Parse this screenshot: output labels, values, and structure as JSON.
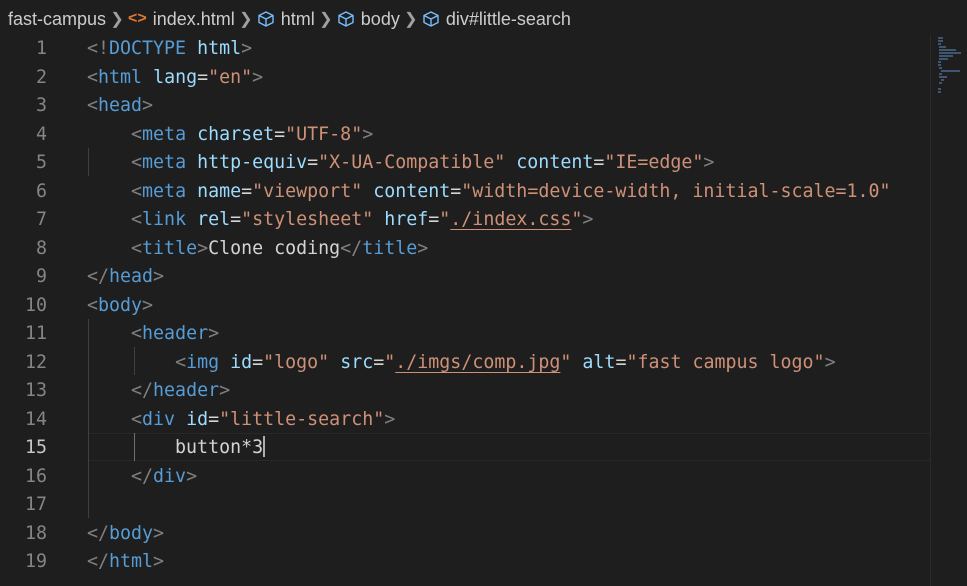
{
  "breadcrumb": {
    "items": [
      {
        "label": "fast-campus",
        "icon": null
      },
      {
        "label": "index.html",
        "icon": "html-file-icon"
      },
      {
        "label": "html",
        "icon": "element-cube-icon"
      },
      {
        "label": "body",
        "icon": "element-cube-icon"
      },
      {
        "label": "div#little-search",
        "icon": "element-cube-icon"
      }
    ]
  },
  "editor": {
    "active_line": 15,
    "line_numbers": [
      "1",
      "2",
      "3",
      "4",
      "5",
      "6",
      "7",
      "8",
      "9",
      "10",
      "11",
      "12",
      "13",
      "14",
      "15",
      "16",
      "17",
      "18",
      "19"
    ],
    "lines": [
      [
        [
          "br",
          "<!"
        ],
        [
          "tag",
          "DOCTYPE"
        ],
        [
          "txt",
          " "
        ],
        [
          "attr",
          "html"
        ],
        [
          "br",
          ">"
        ]
      ],
      [
        [
          "br",
          "<"
        ],
        [
          "tag",
          "html"
        ],
        [
          "txt",
          " "
        ],
        [
          "attr",
          "lang"
        ],
        [
          "txt",
          "="
        ],
        [
          "str",
          "\"en\""
        ],
        [
          "br",
          ">"
        ]
      ],
      [
        [
          "br",
          "<"
        ],
        [
          "tag",
          "head"
        ],
        [
          "br",
          ">"
        ]
      ],
      [
        [
          "txt",
          "    "
        ],
        [
          "br",
          "<"
        ],
        [
          "tag",
          "meta"
        ],
        [
          "txt",
          " "
        ],
        [
          "attr",
          "charset"
        ],
        [
          "txt",
          "="
        ],
        [
          "str",
          "\"UTF-8\""
        ],
        [
          "br",
          ">"
        ]
      ],
      [
        [
          "txt",
          "    "
        ],
        [
          "br",
          "<"
        ],
        [
          "tag",
          "meta"
        ],
        [
          "txt",
          " "
        ],
        [
          "attr",
          "http-equiv"
        ],
        [
          "txt",
          "="
        ],
        [
          "str",
          "\"X-UA-Compatible\""
        ],
        [
          "txt",
          " "
        ],
        [
          "attr",
          "content"
        ],
        [
          "txt",
          "="
        ],
        [
          "str",
          "\"IE=edge\""
        ],
        [
          "br",
          ">"
        ]
      ],
      [
        [
          "txt",
          "    "
        ],
        [
          "br",
          "<"
        ],
        [
          "tag",
          "meta"
        ],
        [
          "txt",
          " "
        ],
        [
          "attr",
          "name"
        ],
        [
          "txt",
          "="
        ],
        [
          "str",
          "\"viewport\""
        ],
        [
          "txt",
          " "
        ],
        [
          "attr",
          "content"
        ],
        [
          "txt",
          "="
        ],
        [
          "str",
          "\"width=device-width, initial-scale=1.0\""
        ]
      ],
      [
        [
          "txt",
          "    "
        ],
        [
          "br",
          "<"
        ],
        [
          "tag",
          "link"
        ],
        [
          "txt",
          " "
        ],
        [
          "attr",
          "rel"
        ],
        [
          "txt",
          "="
        ],
        [
          "str",
          "\"stylesheet\""
        ],
        [
          "txt",
          " "
        ],
        [
          "attr",
          "href"
        ],
        [
          "txt",
          "="
        ],
        [
          "str",
          "\""
        ],
        [
          "link",
          "./index.css"
        ],
        [
          "str",
          "\""
        ],
        [
          "br",
          ">"
        ]
      ],
      [
        [
          "txt",
          "    "
        ],
        [
          "br",
          "<"
        ],
        [
          "tag",
          "title"
        ],
        [
          "br",
          ">"
        ],
        [
          "txt",
          "Clone coding"
        ],
        [
          "br",
          "</"
        ],
        [
          "tag",
          "title"
        ],
        [
          "br",
          ">"
        ]
      ],
      [
        [
          "br",
          "</"
        ],
        [
          "tag",
          "head"
        ],
        [
          "br",
          ">"
        ]
      ],
      [
        [
          "br",
          "<"
        ],
        [
          "tag",
          "body"
        ],
        [
          "br",
          ">"
        ]
      ],
      [
        [
          "txt",
          "    "
        ],
        [
          "br",
          "<"
        ],
        [
          "tag",
          "header"
        ],
        [
          "br",
          ">"
        ]
      ],
      [
        [
          "txt",
          "        "
        ],
        [
          "br",
          "<"
        ],
        [
          "tag",
          "img"
        ],
        [
          "txt",
          " "
        ],
        [
          "attr",
          "id"
        ],
        [
          "txt",
          "="
        ],
        [
          "str",
          "\"logo\""
        ],
        [
          "txt",
          " "
        ],
        [
          "attr",
          "src"
        ],
        [
          "txt",
          "="
        ],
        [
          "str",
          "\""
        ],
        [
          "link",
          "./imgs/comp.jpg"
        ],
        [
          "str",
          "\""
        ],
        [
          "txt",
          " "
        ],
        [
          "attr",
          "alt"
        ],
        [
          "txt",
          "="
        ],
        [
          "str",
          "\"fast campus logo\""
        ],
        [
          "br",
          ">"
        ]
      ],
      [
        [
          "txt",
          "    "
        ],
        [
          "br",
          "</"
        ],
        [
          "tag",
          "header"
        ],
        [
          "br",
          ">"
        ]
      ],
      [
        [
          "txt",
          "    "
        ],
        [
          "br",
          "<"
        ],
        [
          "tag",
          "div"
        ],
        [
          "txt",
          " "
        ],
        [
          "attr",
          "id"
        ],
        [
          "txt",
          "="
        ],
        [
          "str",
          "\"little-search\""
        ],
        [
          "br",
          ">"
        ]
      ],
      [
        [
          "txt",
          "        button*3"
        ]
      ],
      [
        [
          "txt",
          "    "
        ],
        [
          "br",
          "</"
        ],
        [
          "tag",
          "div"
        ],
        [
          "br",
          ">"
        ]
      ],
      [],
      [
        [
          "br",
          "</"
        ],
        [
          "tag",
          "body"
        ],
        [
          "br",
          ">"
        ]
      ],
      [
        [
          "br",
          "</"
        ],
        [
          "tag",
          "html"
        ],
        [
          "br",
          ">"
        ]
      ]
    ]
  },
  "colors": {
    "background": "#1e1e1e",
    "tag": "#569cd6",
    "attribute": "#9cdcfe",
    "string": "#ce9178",
    "bracket": "#808080",
    "text": "#d4d4d4",
    "line_number": "#858585",
    "breadcrumb_html_icon": "#e37933",
    "breadcrumb_cube_icon": "#75beff"
  }
}
